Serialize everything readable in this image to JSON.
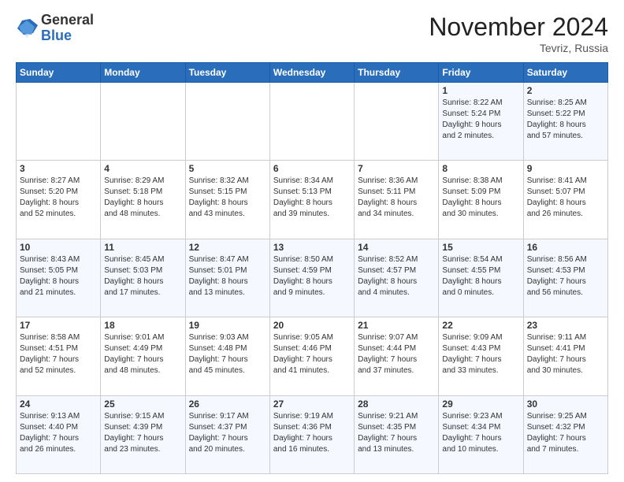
{
  "header": {
    "logo": {
      "general": "General",
      "blue": "Blue"
    },
    "title": "November 2024",
    "location": "Tevriz, Russia"
  },
  "weekdays": [
    "Sunday",
    "Monday",
    "Tuesday",
    "Wednesday",
    "Thursday",
    "Friday",
    "Saturday"
  ],
  "weeks": [
    [
      {
        "day": "",
        "info": ""
      },
      {
        "day": "",
        "info": ""
      },
      {
        "day": "",
        "info": ""
      },
      {
        "day": "",
        "info": ""
      },
      {
        "day": "",
        "info": ""
      },
      {
        "day": "1",
        "info": "Sunrise: 8:22 AM\nSunset: 5:24 PM\nDaylight: 9 hours\nand 2 minutes."
      },
      {
        "day": "2",
        "info": "Sunrise: 8:25 AM\nSunset: 5:22 PM\nDaylight: 8 hours\nand 57 minutes."
      }
    ],
    [
      {
        "day": "3",
        "info": "Sunrise: 8:27 AM\nSunset: 5:20 PM\nDaylight: 8 hours\nand 52 minutes."
      },
      {
        "day": "4",
        "info": "Sunrise: 8:29 AM\nSunset: 5:18 PM\nDaylight: 8 hours\nand 48 minutes."
      },
      {
        "day": "5",
        "info": "Sunrise: 8:32 AM\nSunset: 5:15 PM\nDaylight: 8 hours\nand 43 minutes."
      },
      {
        "day": "6",
        "info": "Sunrise: 8:34 AM\nSunset: 5:13 PM\nDaylight: 8 hours\nand 39 minutes."
      },
      {
        "day": "7",
        "info": "Sunrise: 8:36 AM\nSunset: 5:11 PM\nDaylight: 8 hours\nand 34 minutes."
      },
      {
        "day": "8",
        "info": "Sunrise: 8:38 AM\nSunset: 5:09 PM\nDaylight: 8 hours\nand 30 minutes."
      },
      {
        "day": "9",
        "info": "Sunrise: 8:41 AM\nSunset: 5:07 PM\nDaylight: 8 hours\nand 26 minutes."
      }
    ],
    [
      {
        "day": "10",
        "info": "Sunrise: 8:43 AM\nSunset: 5:05 PM\nDaylight: 8 hours\nand 21 minutes."
      },
      {
        "day": "11",
        "info": "Sunrise: 8:45 AM\nSunset: 5:03 PM\nDaylight: 8 hours\nand 17 minutes."
      },
      {
        "day": "12",
        "info": "Sunrise: 8:47 AM\nSunset: 5:01 PM\nDaylight: 8 hours\nand 13 minutes."
      },
      {
        "day": "13",
        "info": "Sunrise: 8:50 AM\nSunset: 4:59 PM\nDaylight: 8 hours\nand 9 minutes."
      },
      {
        "day": "14",
        "info": "Sunrise: 8:52 AM\nSunset: 4:57 PM\nDaylight: 8 hours\nand 4 minutes."
      },
      {
        "day": "15",
        "info": "Sunrise: 8:54 AM\nSunset: 4:55 PM\nDaylight: 8 hours\nand 0 minutes."
      },
      {
        "day": "16",
        "info": "Sunrise: 8:56 AM\nSunset: 4:53 PM\nDaylight: 7 hours\nand 56 minutes."
      }
    ],
    [
      {
        "day": "17",
        "info": "Sunrise: 8:58 AM\nSunset: 4:51 PM\nDaylight: 7 hours\nand 52 minutes."
      },
      {
        "day": "18",
        "info": "Sunrise: 9:01 AM\nSunset: 4:49 PM\nDaylight: 7 hours\nand 48 minutes."
      },
      {
        "day": "19",
        "info": "Sunrise: 9:03 AM\nSunset: 4:48 PM\nDaylight: 7 hours\nand 45 minutes."
      },
      {
        "day": "20",
        "info": "Sunrise: 9:05 AM\nSunset: 4:46 PM\nDaylight: 7 hours\nand 41 minutes."
      },
      {
        "day": "21",
        "info": "Sunrise: 9:07 AM\nSunset: 4:44 PM\nDaylight: 7 hours\nand 37 minutes."
      },
      {
        "day": "22",
        "info": "Sunrise: 9:09 AM\nSunset: 4:43 PM\nDaylight: 7 hours\nand 33 minutes."
      },
      {
        "day": "23",
        "info": "Sunrise: 9:11 AM\nSunset: 4:41 PM\nDaylight: 7 hours\nand 30 minutes."
      }
    ],
    [
      {
        "day": "24",
        "info": "Sunrise: 9:13 AM\nSunset: 4:40 PM\nDaylight: 7 hours\nand 26 minutes."
      },
      {
        "day": "25",
        "info": "Sunrise: 9:15 AM\nSunset: 4:39 PM\nDaylight: 7 hours\nand 23 minutes."
      },
      {
        "day": "26",
        "info": "Sunrise: 9:17 AM\nSunset: 4:37 PM\nDaylight: 7 hours\nand 20 minutes."
      },
      {
        "day": "27",
        "info": "Sunrise: 9:19 AM\nSunset: 4:36 PM\nDaylight: 7 hours\nand 16 minutes."
      },
      {
        "day": "28",
        "info": "Sunrise: 9:21 AM\nSunset: 4:35 PM\nDaylight: 7 hours\nand 13 minutes."
      },
      {
        "day": "29",
        "info": "Sunrise: 9:23 AM\nSunset: 4:34 PM\nDaylight: 7 hours\nand 10 minutes."
      },
      {
        "day": "30",
        "info": "Sunrise: 9:25 AM\nSunset: 4:32 PM\nDaylight: 7 hours\nand 7 minutes."
      }
    ]
  ]
}
